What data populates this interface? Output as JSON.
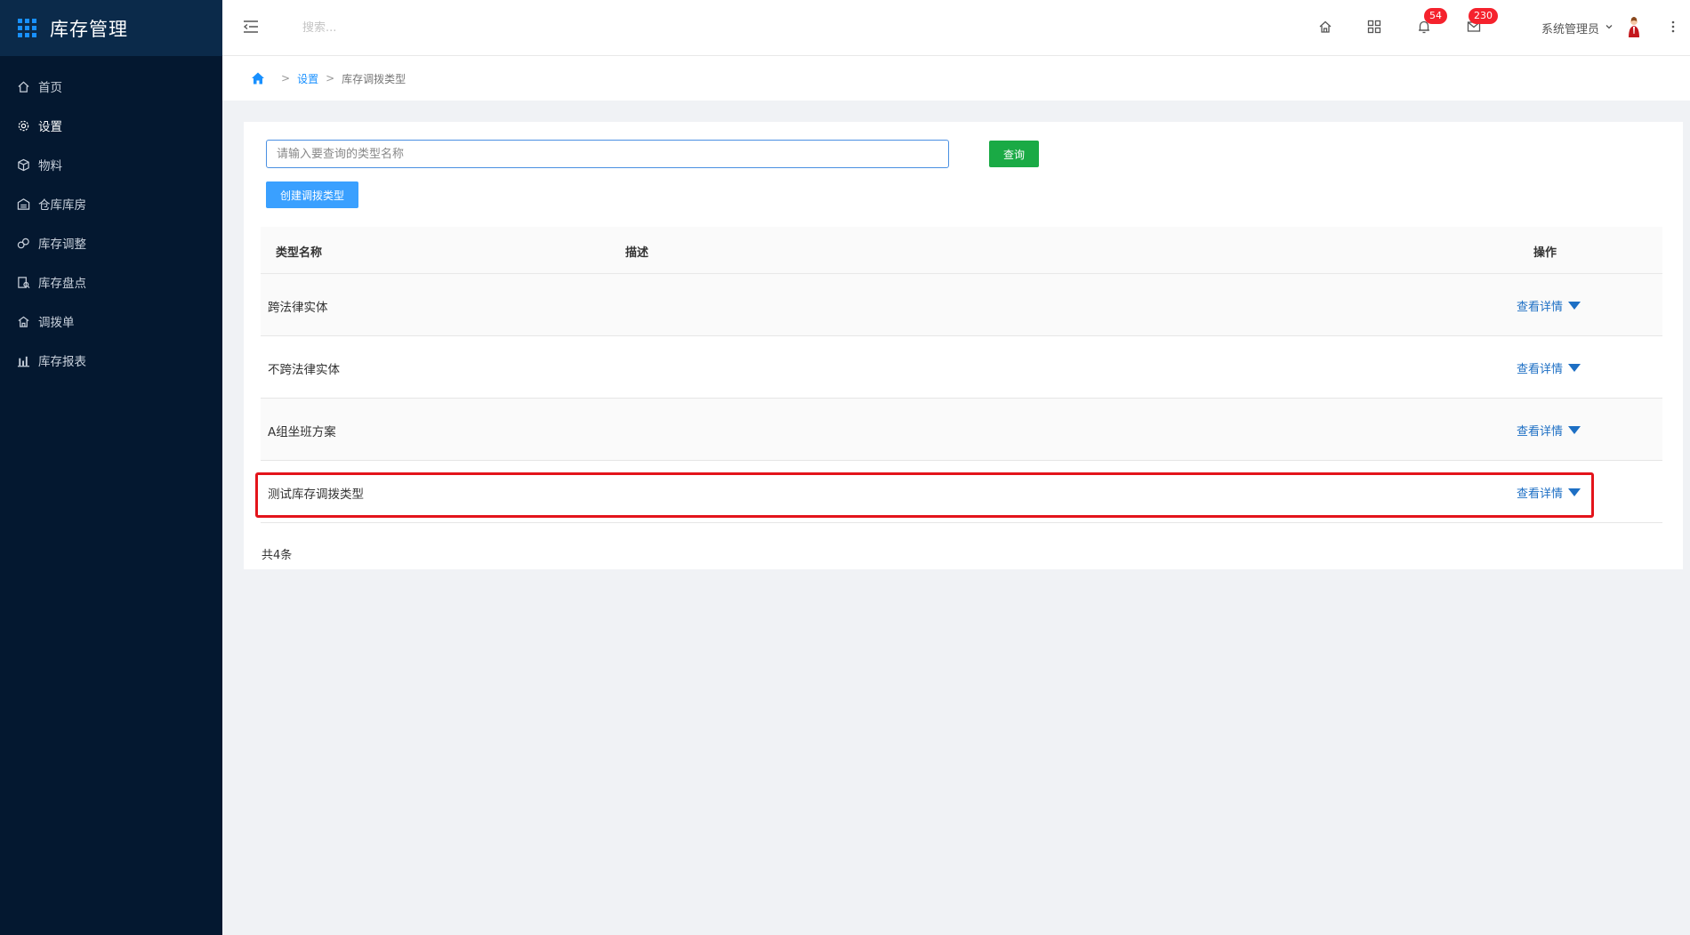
{
  "app": {
    "title": "库存管理"
  },
  "sidebar": {
    "items": [
      {
        "label": "首页",
        "icon": "home-icon"
      },
      {
        "label": "设置",
        "icon": "gear-icon"
      },
      {
        "label": "物料",
        "icon": "cube-icon"
      },
      {
        "label": "仓库库房",
        "icon": "warehouse-icon"
      },
      {
        "label": "库存调整",
        "icon": "adjust-icon"
      },
      {
        "label": "库存盘点",
        "icon": "inventory-check-icon"
      },
      {
        "label": "调拨单",
        "icon": "transfer-icon"
      },
      {
        "label": "库存报表",
        "icon": "bar-chart-icon"
      }
    ],
    "active_label": "设置"
  },
  "topbar": {
    "search_placeholder": "搜索...",
    "notifications_count": "54",
    "messages_count": "230",
    "user_name": "系统管理员"
  },
  "breadcrumb": {
    "level1": "设置",
    "level2": "库存调拨类型",
    "separator": ">"
  },
  "search": {
    "placeholder": "请输入要查询的类型名称",
    "value": ""
  },
  "buttons": {
    "query": "查询",
    "create": "创建调拨类型"
  },
  "table": {
    "columns": {
      "name": "类型名称",
      "description": "描述",
      "action": "操作"
    },
    "rows": [
      {
        "name": "跨法律实体",
        "description": "",
        "action": "查看详情"
      },
      {
        "name": "不跨法律实体",
        "description": "",
        "action": "查看详情"
      },
      {
        "name": "A组坐班方案",
        "description": "",
        "action": "查看详情"
      },
      {
        "name": "测试库存调拨类型",
        "description": "",
        "action": "查看详情"
      }
    ]
  },
  "footer": {
    "total": "共4条"
  },
  "colors": {
    "sidebar_bg": "#041830",
    "accent": "#1890ff",
    "query_button": "#1aaa45",
    "create_button": "#3aa0ff",
    "badge": "#f5222d",
    "highlight": "#e3141b"
  }
}
